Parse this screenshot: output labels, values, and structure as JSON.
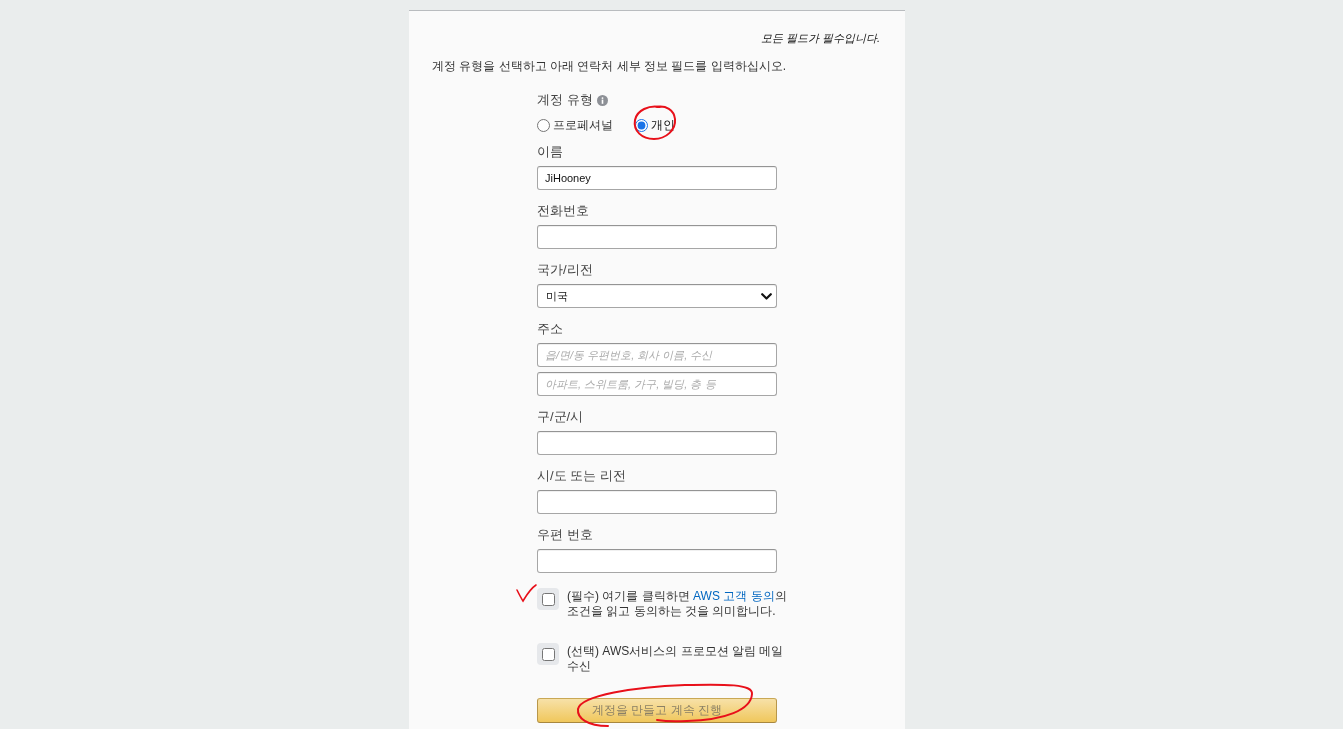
{
  "note": "모든 필드가 필수입니다.",
  "instruction": "계정 유형을 선택하고 아래 연락처 세부 정보 필드를 입력하십시오.",
  "account_type": {
    "label": "계정 유형",
    "options": [
      {
        "label": "프로페셔널",
        "selected": false
      },
      {
        "label": "개인",
        "selected": true,
        "annotation": {
          "kind": "circle"
        }
      }
    ]
  },
  "fields": [
    {
      "kind": "text",
      "label": "이름",
      "value": "JiHooney"
    },
    {
      "kind": "text",
      "label": "전화번호"
    },
    {
      "kind": "select",
      "label": "국가/리전",
      "value": "미국"
    },
    {
      "kind": "text",
      "label": "주소",
      "placeholders": [
        "읍/면/동 우편번호, 회사 이름, 수신",
        "아파트, 스위트룸, 가구, 빌딩, 층 등"
      ]
    },
    {
      "kind": "text",
      "label": "구/군/시"
    },
    {
      "kind": "text",
      "label": "시/도 또는 리전"
    },
    {
      "kind": "text",
      "label": "우편 번호"
    }
  ],
  "agreements": [
    {
      "checked": false,
      "annotation": {
        "kind": "tick"
      },
      "text": "(필수) 여기를 클릭하면 ",
      "link": "AWS 고객 동의",
      "text_after": "의 조건을 읽고 동의하는 것을 의미합니다."
    },
    {
      "checked": false,
      "text": "(선택) AWS서비스의 프로모션 알림 메일 수신"
    }
  ],
  "submit_button": {
    "label": "계정을 만들고 계속 진행",
    "disabled": true,
    "annotation": {
      "kind": "scribble"
    }
  }
}
